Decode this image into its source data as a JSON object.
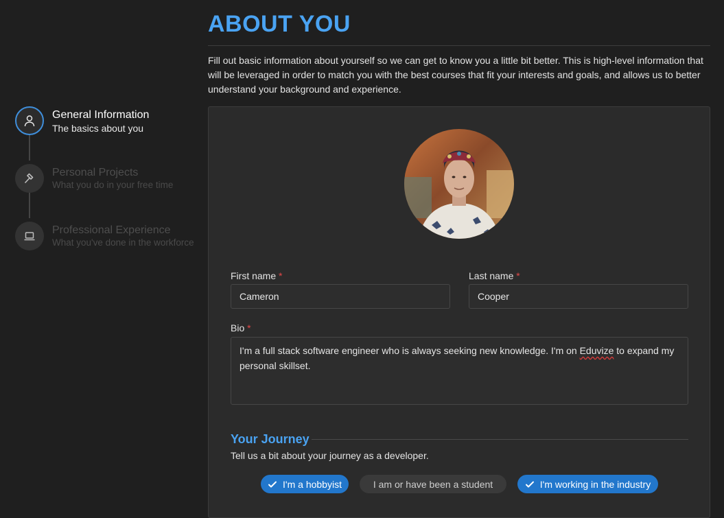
{
  "header": {
    "title": "ABOUT YOU",
    "intro": "Fill out basic information about yourself so we can get to know you a little bit better. This is high-level information that will be leveraged in order to match you with the best courses that fit your interests and goals, and allows us to better understand your background and experience."
  },
  "steps": [
    {
      "title": "General Information",
      "subtitle": "The basics about you",
      "icon": "user-icon",
      "state": "active"
    },
    {
      "title": "Personal Projects",
      "subtitle": "What you do in your free time",
      "icon": "hammer-icon",
      "state": "inactive"
    },
    {
      "title": "Professional Experience",
      "subtitle": "What you've done in the workforce",
      "icon": "laptop-icon",
      "state": "inactive"
    }
  ],
  "form": {
    "first_name": {
      "label": "First name",
      "required_mark": "*",
      "value": "Cameron"
    },
    "last_name": {
      "label": "Last name",
      "required_mark": "*",
      "value": "Cooper"
    },
    "bio": {
      "label": "Bio",
      "required_mark": "*",
      "value_before": "I'm a full stack software engineer who is always seeking new knowledge. I'm on ",
      "value_misspelled": "Eduvize",
      "value_after": " to expand my personal skillset."
    }
  },
  "journey": {
    "title": "Your Journey",
    "subtitle": "Tell us a bit about your journey as a developer.",
    "options": [
      {
        "label": "I'm a hobbyist",
        "selected": true
      },
      {
        "label": "I am or have been a student",
        "selected": false
      },
      {
        "label": "I'm working in the industry",
        "selected": true
      }
    ]
  },
  "colors": {
    "accent": "#4aa3f2",
    "chip_selected": "#2277cc",
    "required": "#e24848"
  }
}
